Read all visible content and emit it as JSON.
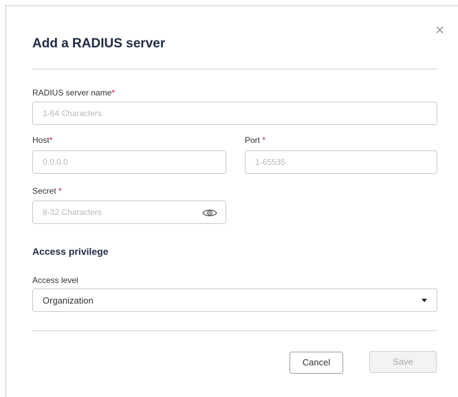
{
  "dialog": {
    "title": "Add a RADIUS server",
    "close_icon": "close-icon"
  },
  "form": {
    "name": {
      "label": "RADIUS server name",
      "required_mark": "*",
      "placeholder": "1-64 Characters",
      "value": ""
    },
    "host": {
      "label": "Host",
      "required_mark": "*",
      "placeholder": "0.0.0.0",
      "value": ""
    },
    "port": {
      "label": "Port ",
      "required_mark": "*",
      "placeholder": "1-65535",
      "value": ""
    },
    "secret": {
      "label": "Secret ",
      "required_mark": "*",
      "placeholder": "8-32 Characters",
      "value": "",
      "toggle_icon": "eye-icon"
    }
  },
  "access": {
    "section_title": "Access privilege",
    "level_label": "Access level",
    "selected": "Organization",
    "dropdown_icon": "caret-down-icon"
  },
  "buttons": {
    "cancel": "Cancel",
    "save": "Save",
    "save_disabled": true
  },
  "colors": {
    "title": "#1f2a44",
    "required": "#d1114b",
    "border": "#c9c9c9",
    "placeholder": "#b8b8b8",
    "disabled_text": "#a9a9a9"
  }
}
